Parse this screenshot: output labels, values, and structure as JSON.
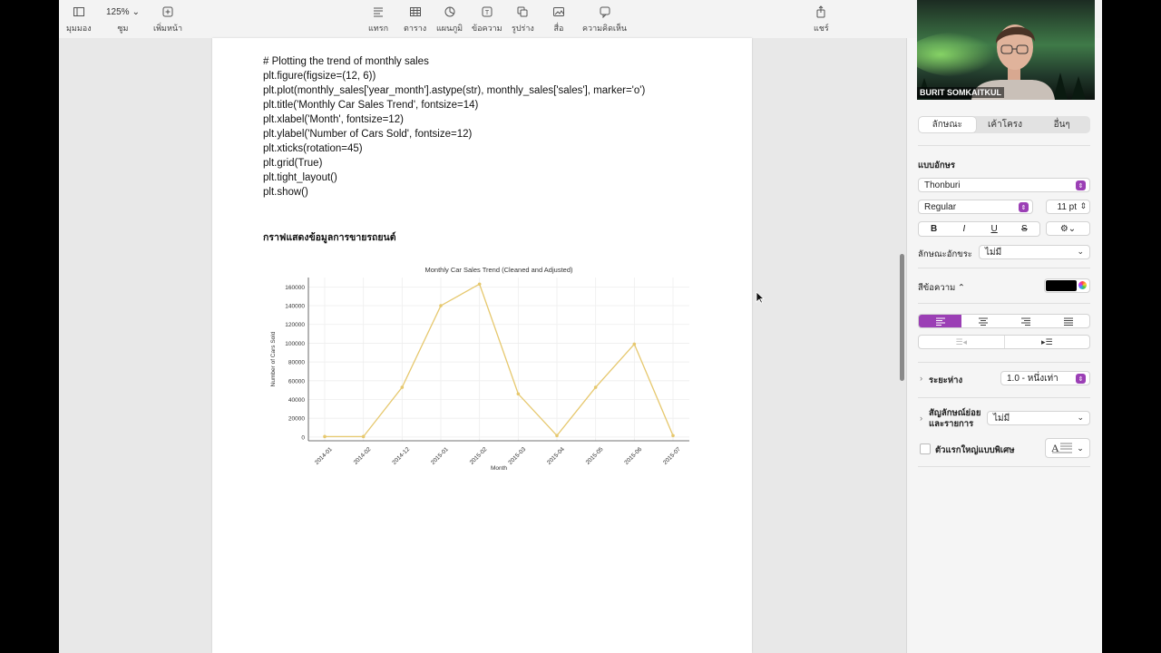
{
  "toolbar": {
    "view_label": "มุมมอง",
    "zoom_value": "125%",
    "zoom_label": "ซูม",
    "add_page_label": "เพิ่มหน้า",
    "insert_label": "แทรก",
    "table_label": "ตาราง",
    "chart_label": "แผนภูมิ",
    "text_label": "ข้อความ",
    "shape_label": "รูปร่าง",
    "media_label": "สื่อ",
    "comment_label": "ความคิดเห็น",
    "share_label": "แชร์"
  },
  "document": {
    "code_lines": [
      "# Plotting the trend of monthly sales",
      "plt.figure(figsize=(12, 6))",
      "plt.plot(monthly_sales['year_month'].astype(str), monthly_sales['sales'], marker='o')",
      "plt.title('Monthly Car Sales Trend', fontsize=14)",
      "plt.xlabel('Month', fontsize=12)",
      "plt.ylabel('Number of Cars Sold', fontsize=12)",
      "plt.xticks(rotation=45)",
      "plt.grid(True)",
      "plt.tight_layout()",
      "plt.show()"
    ],
    "heading": "กราฟแสดงข้อมูลการขายรถยนต์"
  },
  "chart_data": {
    "type": "line",
    "title": "Monthly Car Sales Trend (Cleaned and Adjusted)",
    "xlabel": "Month",
    "ylabel": "Number of Cars Sold",
    "categories": [
      "2014-01",
      "2014-02",
      "2014-12",
      "2015-01",
      "2015-02",
      "2015-03",
      "2015-04",
      "2015-05",
      "2015-06",
      "2015-07"
    ],
    "values": [
      500,
      500,
      53000,
      140000,
      163000,
      46000,
      1500,
      53000,
      99000,
      1500
    ],
    "yticks": [
      0,
      20000,
      40000,
      60000,
      80000,
      100000,
      120000,
      140000,
      160000
    ],
    "ylim": [
      -4000,
      170000
    ],
    "grid": true,
    "color": "#e6c86e"
  },
  "panel": {
    "tabs": [
      "ลักษณะ",
      "เค้าโครง",
      "อื่นๆ"
    ],
    "font_section": "แบบอักษร",
    "font_family": "Thonburi",
    "font_style": "Regular",
    "font_size": "11 pt",
    "bold": "B",
    "italic": "I",
    "underline": "U",
    "strike": "S",
    "char_style_label": "ลักษณะอักขระ",
    "char_style_value": "ไม่มี",
    "text_color_label": "สีข้อความ ⌃",
    "spacing_label": "ระยะห่าง",
    "spacing_value": "1.0 - หนึ่งเท่า",
    "bullets_label_1": "สัญลักษณ์ย่อย",
    "bullets_label_2": "และรายการ",
    "bullets_value": "ไม่มี",
    "dropcap_label": "ตัวแรกใหญ่แบบพิเศษ"
  },
  "webcam": {
    "name": "BURIT SOMKAITKUL"
  }
}
